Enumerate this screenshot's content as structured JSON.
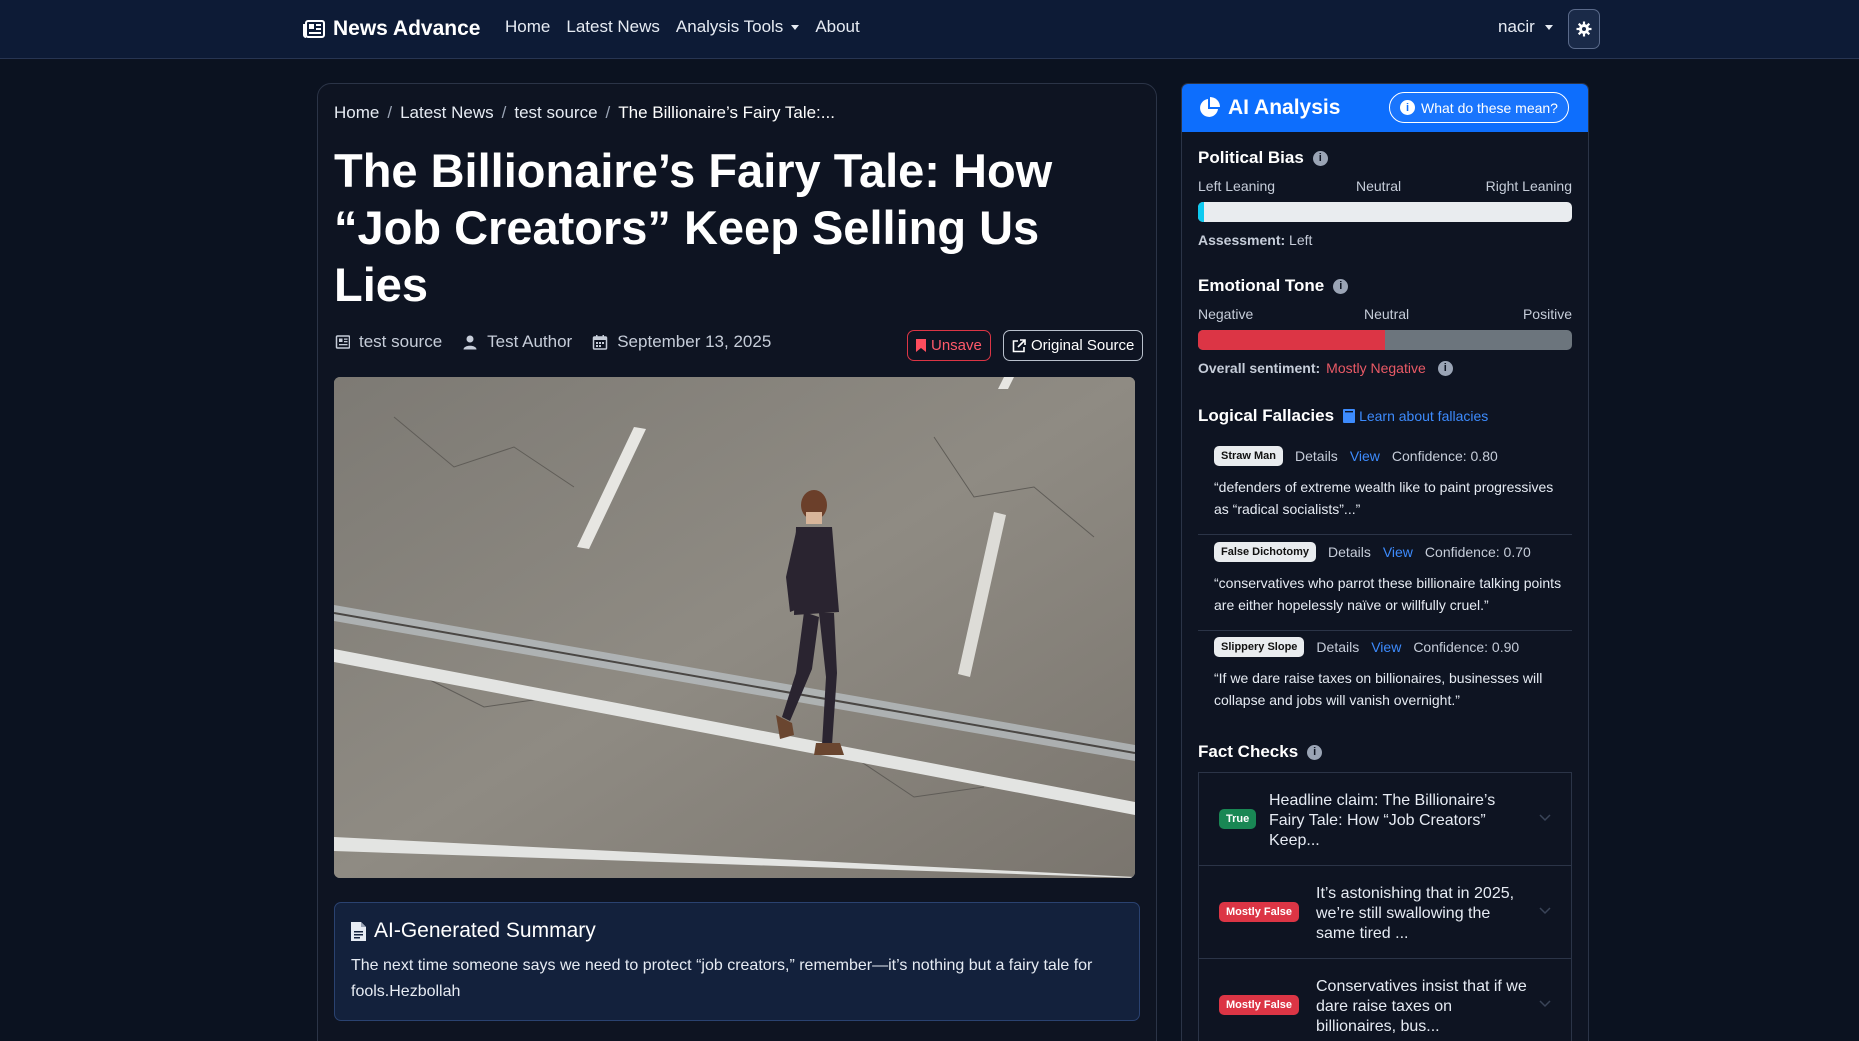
{
  "navbar": {
    "brand": "News Advance",
    "links": [
      "Home",
      "Latest News",
      "Analysis Tools",
      "About"
    ],
    "user": "nacir"
  },
  "breadcrumb": [
    "Home",
    "Latest News",
    "test source",
    "The Billionaire’s Fairy Tale:..."
  ],
  "article": {
    "title": "The Billionaire’s Fairy Tale: How “Job Creators” Keep Selling Us Lies",
    "source": "test source",
    "author": "Test Author",
    "date": "September 13, 2025",
    "unsave_label": "Unsave",
    "original_source_label": "Original Source"
  },
  "summary": {
    "heading": "AI-Generated Summary",
    "text": "The next time someone says we need to protect “job creators,” remember—it’s nothing but a fairy tale for fools.Hezbollah"
  },
  "ai": {
    "title": "AI Analysis",
    "help_label": "What do these mean?",
    "political_bias": {
      "title": "Political Bias",
      "left_label": "Left Leaning",
      "center_label": "Neutral",
      "right_label": "Right Leaning",
      "fill_fraction": 0.015,
      "assessment_label": "Assessment:",
      "assessment_value": "Left"
    },
    "emotional_tone": {
      "title": "Emotional Tone",
      "left_label": "Negative",
      "center_label": "Neutral",
      "right_label": "Positive",
      "fill_fraction": 0.5,
      "sentiment_label": "Overall sentiment:",
      "sentiment_value": "Mostly Negative"
    },
    "fallacies": {
      "title": "Logical Fallacies",
      "learn_label": "Learn about fallacies",
      "details_label": "Details",
      "view_label": "View",
      "items": [
        {
          "name": "Straw Man",
          "confidence": "Confidence: 0.80",
          "quote": "“defenders of extreme wealth like to paint progressives as “radical socialists”...”"
        },
        {
          "name": "False Dichotomy",
          "confidence": "Confidence: 0.70",
          "quote": "“conservatives who parrot these billionaire talking points are either hopelessly naïve or willfully cruel.”"
        },
        {
          "name": "Slippery Slope",
          "confidence": "Confidence: 0.90",
          "quote": "“If we dare raise taxes on billionaires, businesses will collapse and jobs will vanish overnight.”"
        }
      ]
    },
    "fact_checks": {
      "title": "Fact Checks",
      "items": [
        {
          "verdict": "True",
          "color": "#198754",
          "claim": "Headline claim: The Billionaire’s Fairy Tale: How “Job Creators” Keep..."
        },
        {
          "verdict": "Mostly False",
          "color": "#dc3545",
          "claim": "It’s astonishing that in 2025, we’re still swallowing the same tired ..."
        },
        {
          "verdict": "Mostly False",
          "color": "#dc3545",
          "claim": "Conservatives insist that if we dare raise taxes on billionaires, bus..."
        }
      ]
    }
  },
  "colors": {
    "accent": "#0d6efd",
    "bias_fill": "#0dcaf0",
    "negative": "#dc3545",
    "neutral_track": "#6c757d"
  }
}
